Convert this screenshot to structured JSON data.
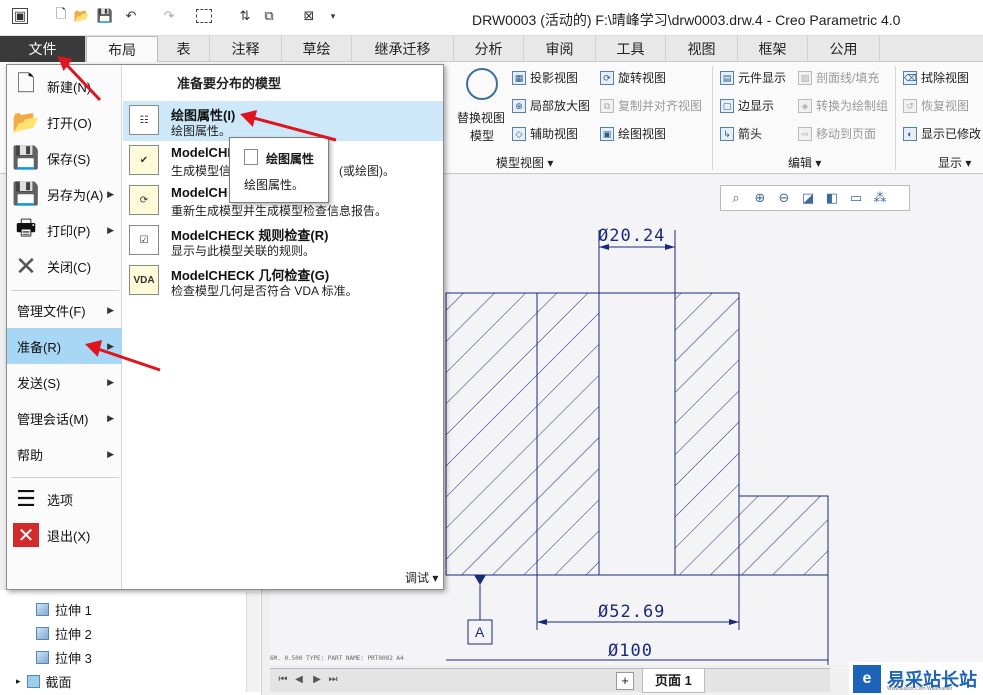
{
  "titlebar": {
    "title": "DRW0003 (活动的) F:\\晴峰学习\\drw0003.drw.4 - Creo Parametric 4.0"
  },
  "tabs": [
    "文件",
    "布局",
    "表",
    "注释",
    "草绘",
    "继承迁移",
    "分析",
    "审阅",
    "工具",
    "视图",
    "框架",
    "公用"
  ],
  "ribbon": {
    "replace_view_line1": "替换视图",
    "replace_view_line2": "模型",
    "projection_view": "投影视图",
    "detail_view": "局部放大图",
    "auxiliary_view": "辅助视图",
    "revolved_view": "旋转视图",
    "copy_align_view": "复制并对齐视图",
    "drawing_view": "绘图视图",
    "model_views_group": "模型视图",
    "element_display": "元件显示",
    "edge_display": "边显示",
    "arrow": "箭头",
    "section_line_fill": "剖面线/填充",
    "convert_to_draft_group": "转换为绘制组",
    "move_to_page": "移动到页面",
    "edit_group": "编辑",
    "erase_view": "拭除视图",
    "restore_view": "恢复视图",
    "show_modified": "显示已修改",
    "display_group": "显示"
  },
  "file_menu": {
    "items": [
      {
        "label": "新建(N)"
      },
      {
        "label": "打开(O)"
      },
      {
        "label": "保存(S)"
      },
      {
        "label": "另存为(A)"
      },
      {
        "label": "打印(P)"
      },
      {
        "label": "关闭(C)"
      },
      {
        "label": "管理文件(F)"
      },
      {
        "label": "准备(R)"
      },
      {
        "label": "发送(S)"
      },
      {
        "label": "管理会话(M)"
      },
      {
        "label": "帮助"
      },
      {
        "label": "选项"
      },
      {
        "label": "退出(X)"
      }
    ],
    "submenu_title": "准备要分布的模型",
    "subitems": [
      {
        "title": "绘图属性(I)",
        "desc": "绘图属性。"
      },
      {
        "title": "ModelCHE",
        "desc": "生成模型信"
      },
      {
        "title": "ModelCH",
        "desc": "重新生成模型并生成模型检查信息报告。"
      },
      {
        "title": "ModelCHECK 规则检查(R)",
        "desc": "显示与此模型关联的规则。"
      },
      {
        "title": "ModelCHECK 几何检查(G)",
        "desc": "检查模型几何是否符合 VDA 标准。"
      }
    ],
    "desc_tail": "(或绘图)。",
    "debug": "调试",
    "vda": "VDA"
  },
  "tooltip": {
    "title": "绘图属性",
    "desc": "绘图属性。"
  },
  "drawing": {
    "dim_top": "Ø20.24",
    "dim_mid": "Ø52.69",
    "dim_bottom": "Ø100",
    "datum": "A"
  },
  "statusline": "6M. 0.500   TYPE: PART   NAME: PRT0002   A4",
  "tree": {
    "items": [
      "拉伸 1",
      "拉伸 2",
      "拉伸 3",
      "截面"
    ]
  },
  "pagebar": {
    "page_label": "页面 1",
    "add": "+"
  },
  "watermark": {
    "text": "易采站长站",
    "sub": "Www.Easck.Com  Webmaster"
  },
  "colors": {
    "accent": "#1d63b8",
    "highlight": "#a8d6f5",
    "drawing_line": "#1a2a7a",
    "arrow_red": "#e0141e"
  }
}
